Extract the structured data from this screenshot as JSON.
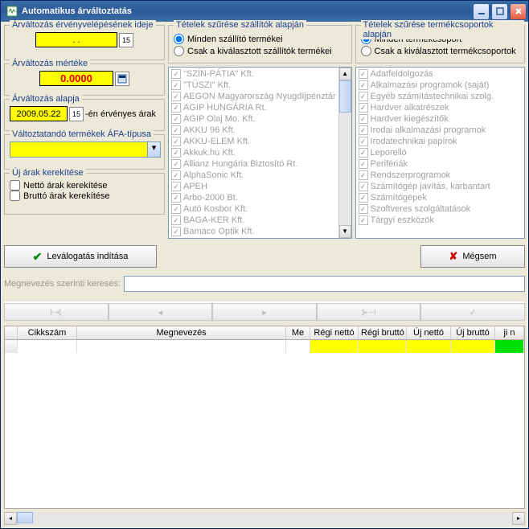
{
  "window": {
    "title": "Automatikus árváltoztatás"
  },
  "panels": {
    "effective_time": {
      "title": "Árváltozás érvényvelépésének ideje",
      "value": "  .  .    "
    },
    "change_amount": {
      "title": "Árváltozás mértéke",
      "value": "0.0000"
    },
    "change_basis": {
      "title": "Árváltozás alapja",
      "date": "2009.05.22",
      "suffix": " -én érvényes árak"
    },
    "vat_type": {
      "title": "Változtatandó termékek ÁFA-típusa",
      "value": ""
    },
    "rounding": {
      "title": "Új árak kerekítése",
      "net": "Nettó árak kerekítése",
      "gross": "Bruttó árak kerekítése"
    }
  },
  "suppliers": {
    "title": "Tételek szűrése szállítók alapján",
    "opt_all": "Minden szállító termékei",
    "opt_selected": "Csak a kiválasztott szállítók termékei",
    "items": [
      "\"SZÍN-PÁTIA\" Kft.",
      "\"TÜSZI\" Kft.",
      "AEGON Magyarország Nyugdíjpénztár",
      "AGIP HUNGÁRIA Rt.",
      "AGIP Olaj Mo. Kft.",
      "AKKU 96 Kft.",
      "AKKU-ELEM Kft.",
      "Akkuk.hu Kft.",
      "Allianz Hungária Biztosító Rt.",
      "AlphaSonic Kft.",
      "APEH",
      "Arbo-2000 Bt.",
      "Autó Kosbor Kft.",
      "BAGA-KER Kft.",
      "Bamaco Optik Kft."
    ]
  },
  "product_groups": {
    "title": "Tételek szűrése termékcsoportok alapján",
    "opt_all": "Minden termékcsoport",
    "opt_selected": "Csak a kiválasztott termékcsoportok",
    "items": [
      "Adatfeldolgozás",
      "Alkalmazási programok (saját)",
      "Egyéb számítástechnikai szolg.",
      "Hardver alkatrészek",
      "Hardver kiegészítők",
      "Irodai alkalmazási programok",
      "Irodatechnikai papírok",
      "Leporelló",
      "Perifériák",
      "Rendszerprogramok",
      "Számítógép javítás, karbantart",
      "Számítógépek",
      "Szoftveres szolgáltatások",
      "Tárgyi eszközök"
    ]
  },
  "buttons": {
    "start": "Leválogatás indítása",
    "cancel": "Mégsem"
  },
  "search_label": "Megnevezés szerinti keresés:",
  "grid": {
    "cols": [
      "Cikkszám",
      "Megnevezés",
      "Me",
      "Régi nettó",
      "Régi bruttó",
      "Új nettó",
      "Új bruttó",
      "ji n"
    ]
  },
  "chart_data": {
    "type": "table",
    "columns": [
      "Cikkszám",
      "Megnevezés",
      "Me",
      "Régi nettó",
      "Régi bruttó",
      "Új nettó",
      "Új bruttó"
    ],
    "rows": []
  }
}
